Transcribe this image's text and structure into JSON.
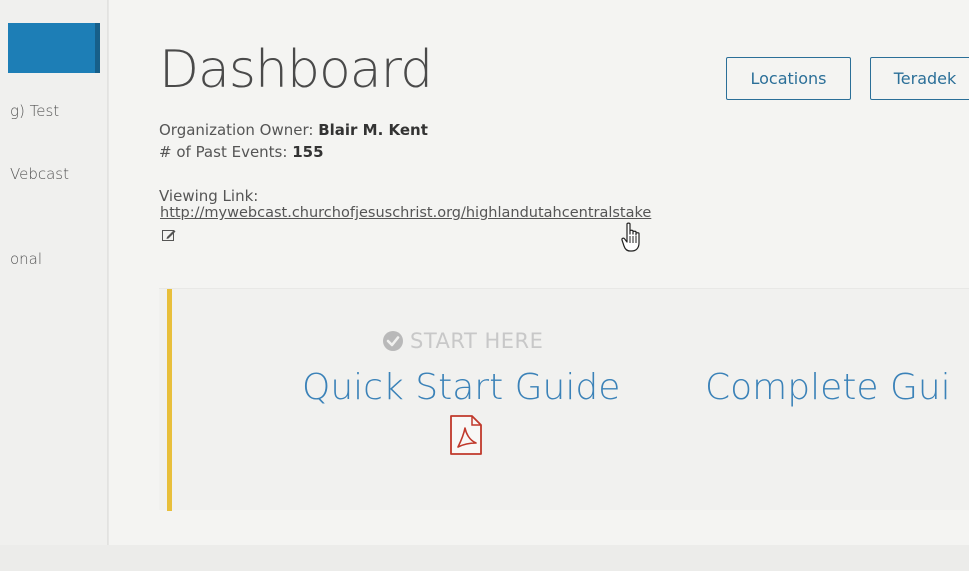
{
  "sidebar": {
    "items": [
      {
        "label": "g) Test"
      },
      {
        "label": "Vebcast"
      },
      {
        "label": "onal"
      }
    ]
  },
  "header": {
    "title": "Dashboard",
    "buttons": {
      "locations": "Locations",
      "teradek": "Teradek"
    }
  },
  "info": {
    "owner_label": "Organization Owner: ",
    "owner_value": "Blair M. Kent",
    "events_label": "# of Past Events: ",
    "events_value": "155",
    "viewing_label": "Viewing Link:",
    "viewing_url": "http://mywebcast.churchofjesuschrist.org/highlandutahcentralstake"
  },
  "start_panel": {
    "start_here": "START HERE",
    "quick_start": "Quick Start Guide",
    "complete_guide": "Complete Gui"
  },
  "icons": {
    "edit": "edit-icon",
    "cursor": "hand-pointer-icon",
    "check": "check-circle-icon",
    "pdf": "pdf-icon"
  },
  "colors": {
    "accent_blue": "#3b82b8",
    "button_border": "#2b6f98",
    "sidebar_active": "#1d7eb6",
    "panel_bar": "#e8bf3b",
    "pdf_red": "#c0392b"
  }
}
